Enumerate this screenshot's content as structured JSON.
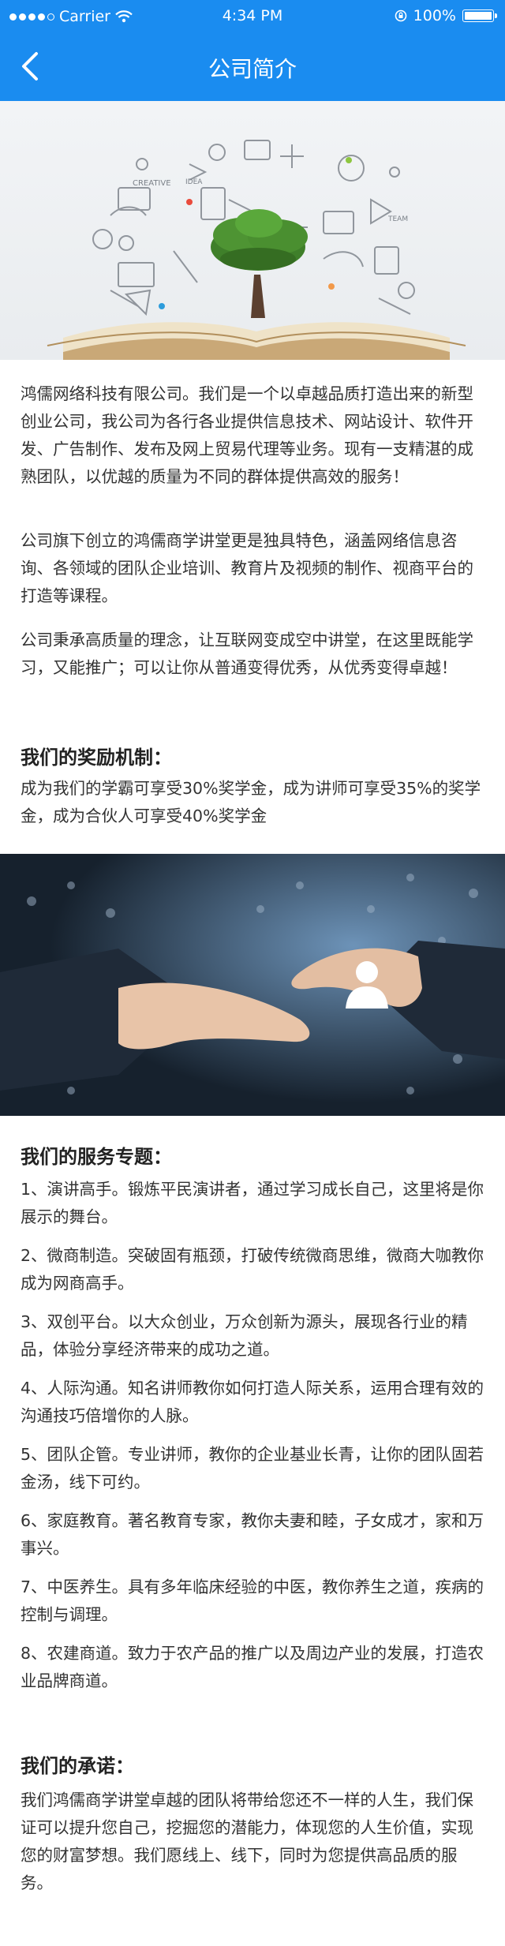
{
  "status_bar": {
    "carrier": "Carrier",
    "time": "4:34 PM",
    "battery": "100%"
  },
  "nav": {
    "title": "公司简介"
  },
  "intro": [
    "鸿儒网络科技有限公司。我们是一个以卓越品质打造出来的新型创业公司，我公司为各行各业提供信息技术、网站设计、软件开发、广告制作、发布及网上贸易代理等业务。现有一支精湛的成熟团队，以优越的质量为不同的群体提供高效的服务！",
    "公司旗下创立的鸿儒商学讲堂更是独具特色，涵盖网络信息咨询、各领域的团队企业培训、教育片及视频的制作、视商平台的打造等课程。",
    "公司秉承高质量的理念，让互联网变成空中讲堂，在这里既能学习，又能推广；可以让你从普通变得优秀，从优秀变得卓越！"
  ],
  "reward": {
    "heading": "我们的奖励机制：",
    "text": "成为我们的学霸可享受30%奖学金，成为讲师可享受35%的奖学金，成为合伙人可享受40%奖学金"
  },
  "services": {
    "heading": "我们的服务专题：",
    "items": [
      "1、演讲高手。锻炼平民演讲者，通过学习成长自己，这里将是你展示的舞台。",
      "2、微商制造。突破固有瓶颈，打破传统微商思维，微商大咖教你成为网商高手。",
      "3、双创平台。以大众创业，万众创新为源头，展现各行业的精品，体验分享经济带来的成功之道。",
      "4、人际沟通。知名讲师教你如何打造人际关系，运用合理有效的沟通技巧倍增你的人脉。",
      "5、团队企管。专业讲师，教你的企业基业长青，让你的团队固若金汤，线下可约。",
      "6、家庭教育。著名教育专家，教你夫妻和睦，子女成才，家和万事兴。",
      "7、中医养生。具有多年临床经验的中医，教你养生之道，疾病的控制与调理。",
      "8、农建商道。致力于农产品的推广以及周边产业的发展，打造农业品牌商道。"
    ]
  },
  "promise": {
    "heading": "我们的承诺：",
    "text": "我们鸿儒商学讲堂卓越的团队将带给您还不一样的人生，我们保证可以提升您自己，挖掘您的潜能力，体现您的人生价值，实现您的财富梦想。我们愿线上、线下，同时为您提供高品质的服务。"
  },
  "hero_doodles": [
    "CREATIVE",
    "IDEA",
    "TEAM"
  ],
  "colors": {
    "brand": "#1a8cf0"
  },
  "icons": [
    "signal-dots-icon",
    "wifi-icon",
    "rotation-lock-icon",
    "battery-icon",
    "back-chevron-icon"
  ]
}
